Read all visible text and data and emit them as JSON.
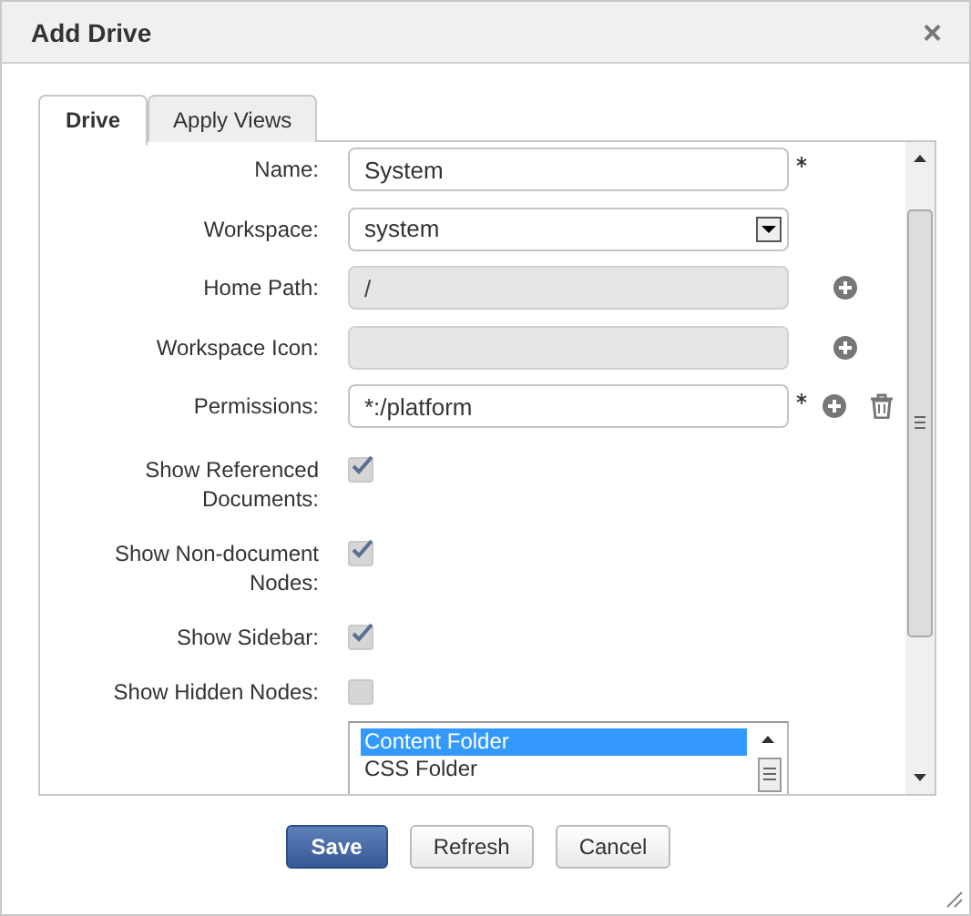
{
  "window": {
    "title": "Add Drive",
    "close": "×"
  },
  "tabs": [
    {
      "label": "Drive",
      "selected": true
    },
    {
      "label": "Apply Views",
      "selected": false
    }
  ],
  "fields": [
    {
      "kind": "text",
      "label": "Name:",
      "value": "System",
      "required": true,
      "disabled": false,
      "add_button": false,
      "delete_button": false
    },
    {
      "kind": "select",
      "label": "Workspace:",
      "value": "system",
      "required": false,
      "disabled": false,
      "add_button": false,
      "delete_button": false
    },
    {
      "kind": "text",
      "label": "Home Path:",
      "value": "/",
      "required": false,
      "disabled": true,
      "add_button": true,
      "delete_button": false
    },
    {
      "kind": "text",
      "label": "Workspace Icon:",
      "required": false,
      "disabled": true,
      "add_button": true,
      "delete_button": false
    },
    {
      "kind": "text",
      "label": "Permissions:",
      "value": "*:/platform",
      "required": true,
      "disabled": false,
      "add_button": true,
      "delete_button": true
    },
    {
      "kind": "checkbox",
      "label": "Show Referenced Documents:",
      "checked": true
    },
    {
      "kind": "checkbox",
      "label": "Show Non-document Nodes:",
      "checked": true
    },
    {
      "kind": "checkbox",
      "label": "Show Sidebar:",
      "checked": true
    },
    {
      "kind": "checkbox",
      "label": "Show Hidden Nodes:",
      "checked": false
    },
    {
      "kind": "listbox",
      "items": [
        {
          "label": "Content Folder",
          "selected": true
        },
        {
          "label": "CSS Folder",
          "selected": false
        }
      ]
    }
  ],
  "buttons": [
    {
      "label": "Save",
      "kind": "primary"
    },
    {
      "label": "Refresh",
      "kind": "default"
    },
    {
      "label": "Cancel",
      "kind": "default"
    }
  ]
}
